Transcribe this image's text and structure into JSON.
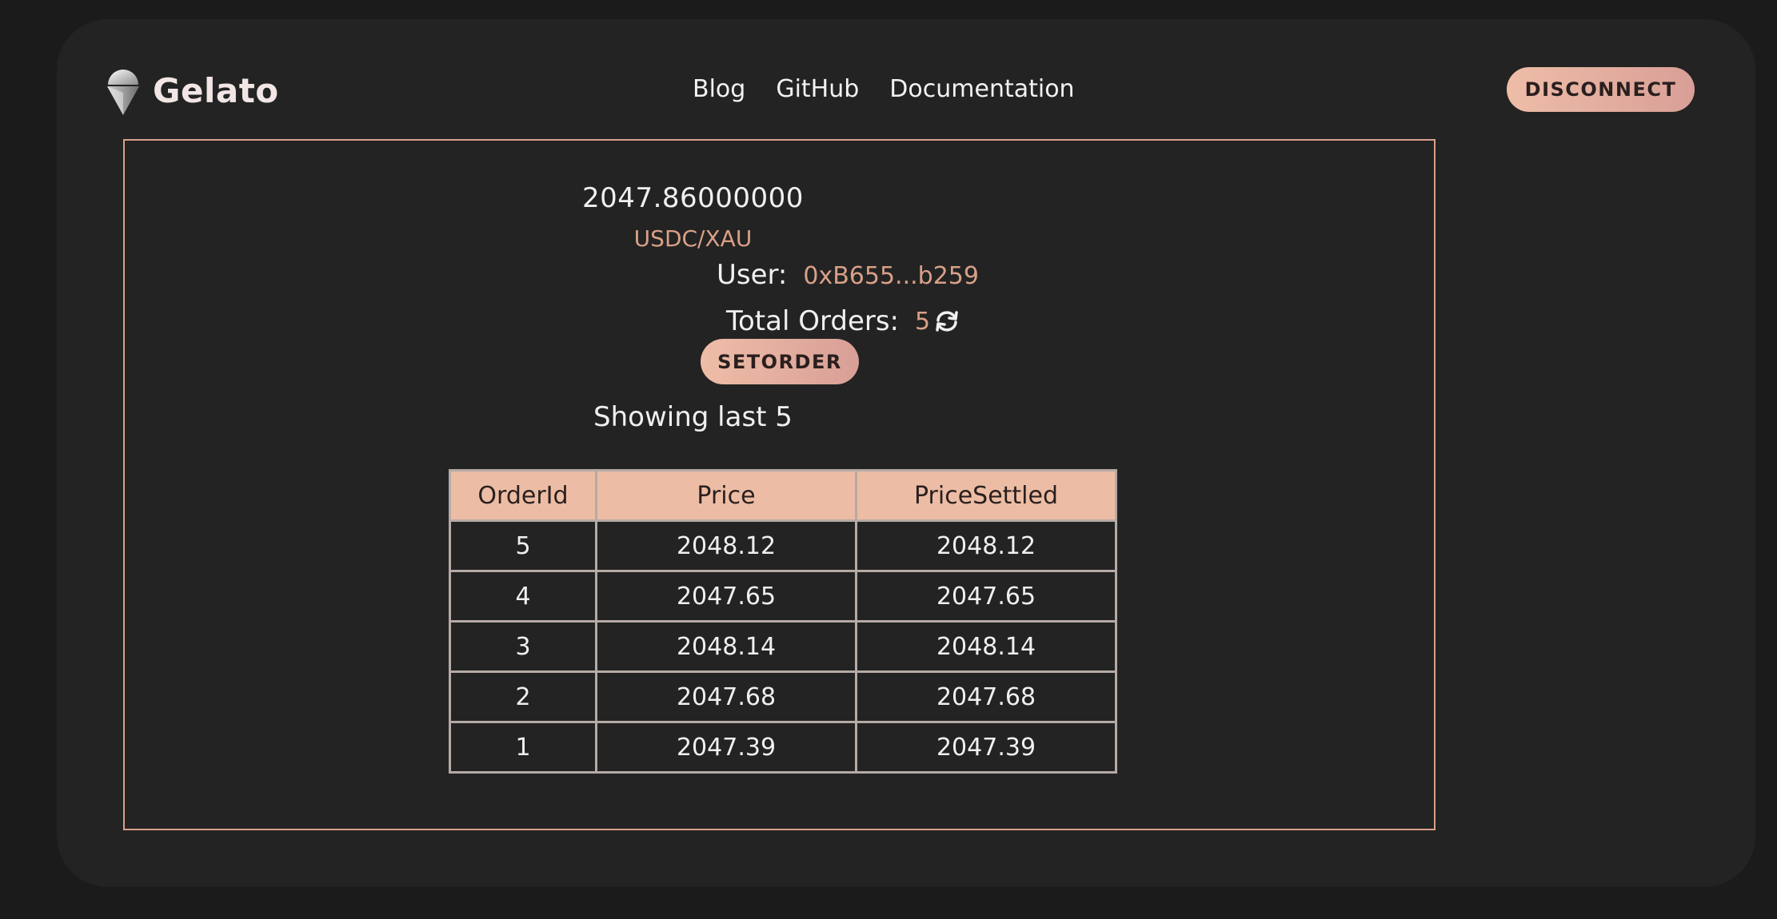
{
  "header": {
    "logo_text": "Gelato",
    "nav": [
      "Blog",
      "GitHub",
      "Documentation"
    ],
    "disconnect_label": "DISCONNECT"
  },
  "main": {
    "price": "2047.86000000",
    "pair": "USDC/XAU",
    "user_label": "User:",
    "user_address": "0xB655...b259",
    "total_orders_label": "Total Orders:",
    "total_orders_count": "5",
    "setorder_label": "SETORDER",
    "showing_text": "Showing last 5",
    "table": {
      "headers": [
        "OrderId",
        "Price",
        "PriceSettled"
      ],
      "rows": [
        [
          "5",
          "2048.12",
          "2048.12"
        ],
        [
          "4",
          "2047.65",
          "2047.65"
        ],
        [
          "3",
          "2048.14",
          "2048.14"
        ],
        [
          "2",
          "2047.68",
          "2047.68"
        ],
        [
          "1",
          "2047.39",
          "2047.39"
        ]
      ]
    }
  },
  "colors": {
    "accent": "#d9a088",
    "button_gradient_start": "#eebda7",
    "button_gradient_end": "#d89f97",
    "background": "#1b1b1b",
    "card": "#232323"
  },
  "icons": {
    "logo": "gelato-cone-icon",
    "refresh": "refresh-icon"
  }
}
